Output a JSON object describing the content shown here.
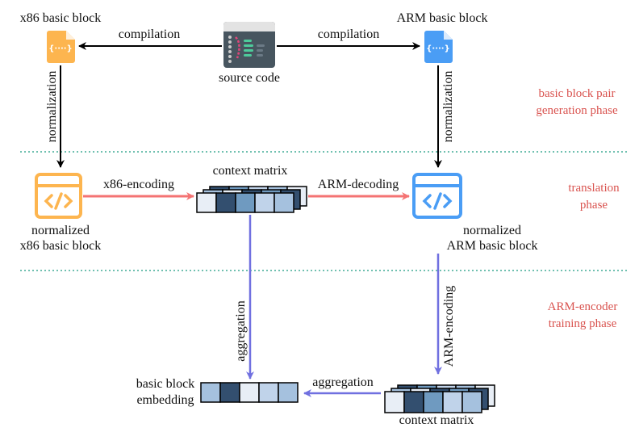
{
  "labels": {
    "x86_block": "x86 basic block",
    "arm_block": "ARM basic block",
    "compilation_left": "compilation",
    "compilation_right": "compilation",
    "source_code": "source code",
    "normalization_left": "normalization",
    "normalization_right": "normalization",
    "context_matrix_top": "context matrix",
    "x86_encoding": "x86-encoding",
    "arm_decoding": "ARM-decoding",
    "normalized_x86_1": "normalized",
    "normalized_x86_2": "x86 basic block",
    "normalized_arm_1": "normalized",
    "normalized_arm_2": "ARM basic block",
    "aggregation_vertical": "aggregation",
    "arm_encoding": "ARM-encoding",
    "aggregation_horizontal": "aggregation",
    "embedding_1": "basic block",
    "embedding_2": "embedding",
    "context_matrix_bottom": "context matrix"
  },
  "phases": {
    "phase1_1": "basic block pair",
    "phase1_2": "generation phase",
    "phase2_1": "translation",
    "phase2_2": "phase",
    "phase3_1": "ARM-encoder",
    "phase3_2": "training phase"
  },
  "colors": {
    "x86": "#fdb54f",
    "arm": "#4a9df5",
    "encode_arrow": "#f47373",
    "aggregate_arrow": "#7070e0",
    "phase_text": "#d9534f",
    "divider": "#1a9a80",
    "cells": [
      "#e8eef6",
      "#334f6f",
      "#6f9ac0",
      "#c0d3ea",
      "#a5c1de"
    ]
  },
  "icons": [
    "file-code-icon",
    "source-code-window-icon",
    "code-window-icon"
  ]
}
